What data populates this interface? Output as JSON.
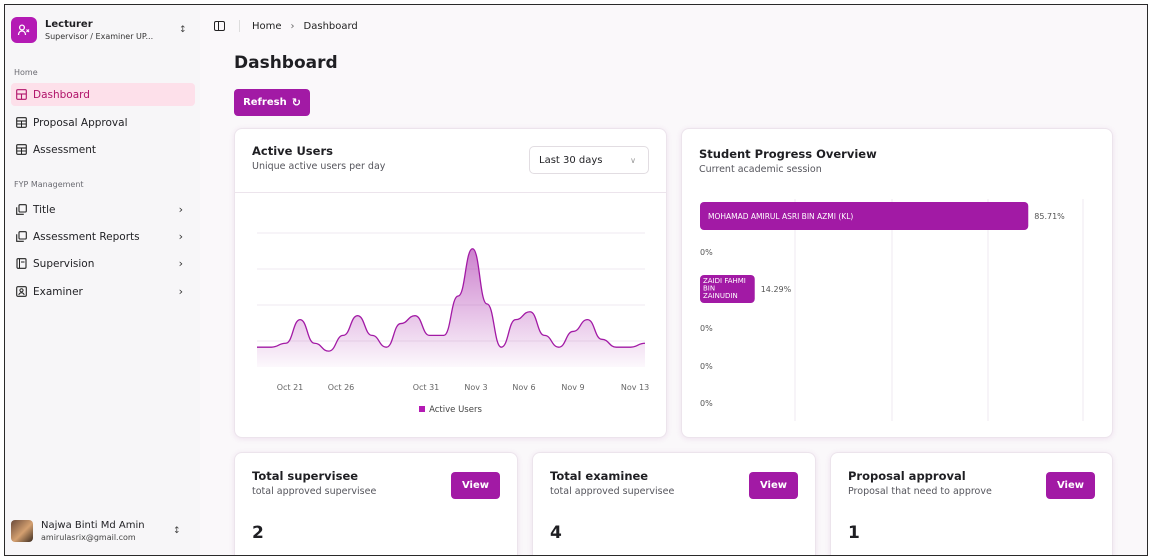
{
  "team": {
    "name": "Lecturer",
    "role": "Supervisor / Examiner UP..."
  },
  "sidebar": {
    "group_home": "Home",
    "group_fyp": "FYP Management",
    "items": [
      {
        "label": "Dashboard",
        "icon": "layout-dashboard-icon"
      },
      {
        "label": "Proposal Approval",
        "icon": "table-icon"
      },
      {
        "label": "Assessment",
        "icon": "table-icon"
      },
      {
        "label": "Title",
        "icon": "copy-icon"
      },
      {
        "label": "Assessment Reports",
        "icon": "copy-icon"
      },
      {
        "label": "Supervision",
        "icon": "book-icon"
      },
      {
        "label": "Examiner",
        "icon": "id-card-icon"
      }
    ]
  },
  "user": {
    "name": "Najwa Binti Md Amin",
    "email": "amirulasrix@gmail.com"
  },
  "breadcrumb": {
    "home": "Home",
    "current": "Dashboard"
  },
  "page": {
    "title": "Dashboard",
    "refresh_label": "Refresh"
  },
  "active_users": {
    "title": "Active Users",
    "subtitle": "Unique active users per day",
    "range": "Last 30 days",
    "legend": "Active Users"
  },
  "student_progress": {
    "title": "Student Progress Overview",
    "subtitle": "Current academic session"
  },
  "stats": [
    {
      "title": "Total supervisee",
      "subtitle": "total approved supervisee",
      "value": "2",
      "button": "View"
    },
    {
      "title": "Total examinee",
      "subtitle": "total approved supervisee",
      "value": "4",
      "button": "View"
    },
    {
      "title": "Proposal approval",
      "subtitle": "Proposal that need to approve",
      "value": "1",
      "button": "View"
    }
  ],
  "colors": {
    "accent": "#a21aa5",
    "active_nav_bg": "#fde0ea",
    "active_nav_text": "#b0136a"
  },
  "chart_data": [
    {
      "type": "area",
      "title": "Active Users",
      "x_ticks": [
        "Oct 21",
        "Oct 26",
        "Oct 31",
        "Nov 3",
        "Nov 6",
        "Nov 9",
        "Nov 13"
      ],
      "x": [
        "Oct 18",
        "Oct 19",
        "Oct 20",
        "Oct 21",
        "Oct 22",
        "Oct 23",
        "Oct 24",
        "Oct 25",
        "Oct 26",
        "Oct 27",
        "Oct 28",
        "Oct 29",
        "Oct 30",
        "Oct 31",
        "Nov 1",
        "Nov 2",
        "Nov 3",
        "Nov 4",
        "Nov 5",
        "Nov 6",
        "Nov 7",
        "Nov 8",
        "Nov 9",
        "Nov 10",
        "Nov 11",
        "Nov 12",
        "Nov 13",
        "Nov 14"
      ],
      "series": [
        {
          "name": "Active Users",
          "values": [
            0.3,
            0.3,
            0.4,
            1.0,
            0.4,
            0.2,
            0.6,
            1.1,
            0.6,
            0.3,
            0.9,
            1.1,
            0.6,
            0.6,
            1.6,
            2.8,
            1.4,
            0.3,
            1.0,
            1.2,
            0.6,
            0.3,
            0.7,
            1.0,
            0.5,
            0.3,
            0.3,
            0.4
          ]
        }
      ],
      "grid": true,
      "legend": "bottom"
    },
    {
      "type": "bar",
      "orientation": "horizontal",
      "title": "Student Progress Overview",
      "categories": [
        "MOHAMAD AMIRUL ASRI BIN AZMI (KL)",
        "",
        "ZAIDI FAHMI BIN ZAINUDIN",
        "",
        "",
        ""
      ],
      "values": [
        85.71,
        0,
        14.29,
        0,
        0,
        0
      ],
      "value_labels": [
        "85.71%",
        "0%",
        "14.29%",
        "0%",
        "0%",
        "0%"
      ],
      "xlim": [
        0,
        100
      ]
    }
  ]
}
